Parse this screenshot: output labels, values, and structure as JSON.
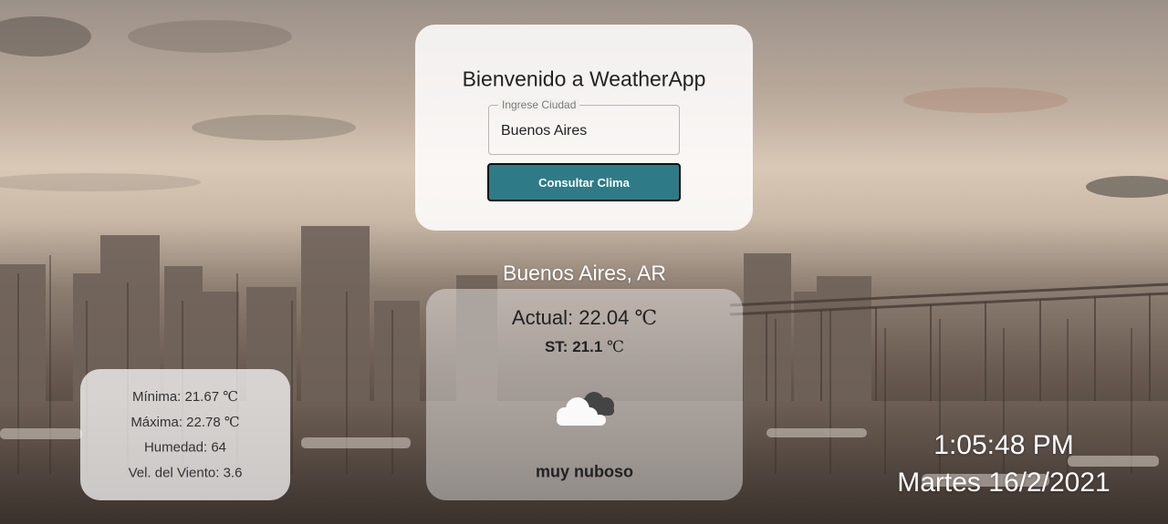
{
  "header": {
    "title": "Bienvenido a WeatherApp"
  },
  "search": {
    "label": "Ingrese Ciudad",
    "value": "Buenos Aires",
    "button_label": "Consultar Clima"
  },
  "weather": {
    "location": "Buenos Aires, AR",
    "actual_label": "Actual:",
    "actual_value": "22.04",
    "st_label": "ST:",
    "st_value": "21.1",
    "unit": "℃",
    "description": "muy nuboso",
    "icon": "cloudy-icon"
  },
  "details": {
    "min_label": "Mínima:",
    "min_value": "21.67",
    "max_label": "Máxima:",
    "max_value": "22.78",
    "unit": "℃",
    "humidity_label": "Humedad:",
    "humidity_value": "64",
    "wind_label": "Vel. del Viento:",
    "wind_value": "3.6"
  },
  "datetime": {
    "time": "1:05:48 PM",
    "date": "Martes 16/2/2021"
  },
  "colors": {
    "button": "#2e7b87",
    "card": "#ffffff"
  }
}
